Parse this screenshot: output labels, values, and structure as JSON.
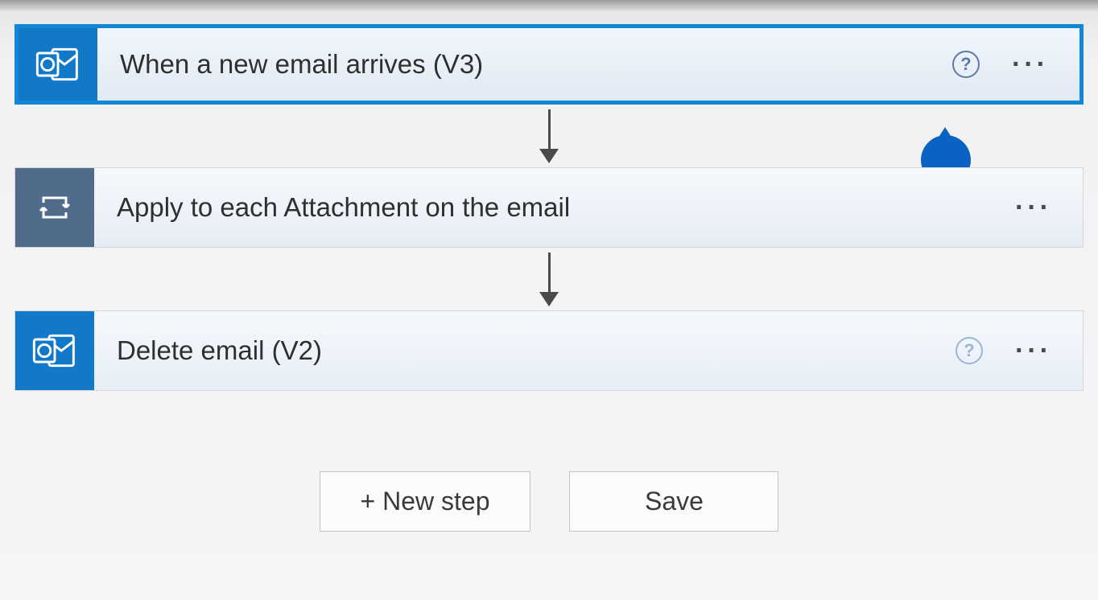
{
  "steps": [
    {
      "title": "When a new email arrives (V3)",
      "connector": "outlook",
      "selected": true,
      "has_help": true
    },
    {
      "title": "Apply to each Attachment on the email",
      "connector": "control",
      "selected": false,
      "has_help": false
    },
    {
      "title": "Delete email (V2)",
      "connector": "outlook",
      "selected": false,
      "has_help": true
    }
  ],
  "buttons": {
    "new_step": "+ New step",
    "save": "Save"
  },
  "help_glyph": "?"
}
